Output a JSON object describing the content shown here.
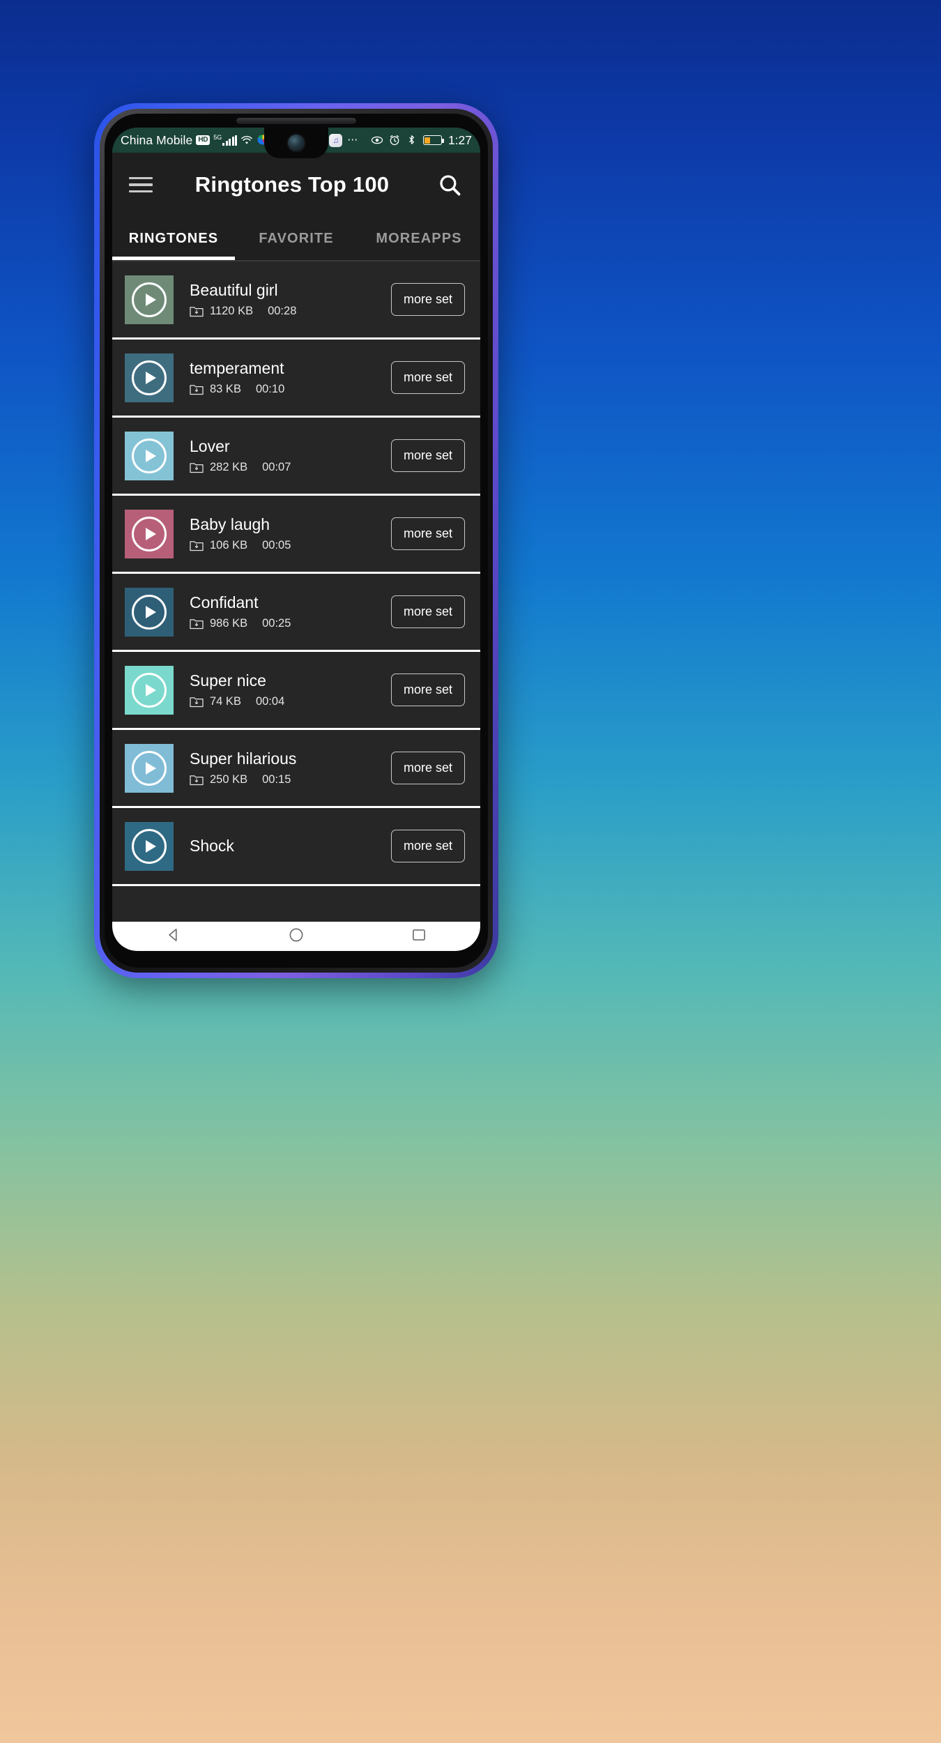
{
  "statusbar": {
    "carrier": "China Mobile",
    "hd_badge": "HD",
    "network_label": "5G",
    "time": "1:27",
    "icons": {
      "signal": "signal-bars-icon",
      "wifi": "wifi-icon",
      "color_app": "color-app-icon",
      "music": "music-notification-icon",
      "overflow": "more-notifications-icon",
      "eye": "eye-care-icon",
      "alarm": "alarm-clock-icon",
      "bluetooth": "bluetooth-icon",
      "battery": "battery-icon"
    }
  },
  "appbar": {
    "menu_icon": "hamburger-menu-icon",
    "title": "Ringtones Top 100",
    "search_icon": "search-icon"
  },
  "tabs": [
    {
      "label": "RINGTONES",
      "active": true
    },
    {
      "label": "FAVORITE",
      "active": false
    },
    {
      "label": "MOREAPPS",
      "active": false
    }
  ],
  "list": {
    "button_label": "more set",
    "items": [
      {
        "title": "Beautiful girl",
        "size": "1120 KB",
        "duration": "00:28",
        "color": "#6f8b78"
      },
      {
        "title": "temperament",
        "size": "83 KB",
        "duration": "00:10",
        "color": "#3f6d80"
      },
      {
        "title": "Lover",
        "size": "282 KB",
        "duration": "00:07",
        "color": "#84c3d6"
      },
      {
        "title": "Baby laugh",
        "size": "106 KB",
        "duration": "00:05",
        "color": "#b75f79"
      },
      {
        "title": "Confidant",
        "size": "986 KB",
        "duration": "00:25",
        "color": "#2f5f77"
      },
      {
        "title": "Super nice",
        "size": "74 KB",
        "duration": "00:04",
        "color": "#7ad9cc"
      },
      {
        "title": "Super hilarious",
        "size": "250 KB",
        "duration": "00:15",
        "color": "#80bcd6"
      },
      {
        "title": "Shock",
        "size": "",
        "duration": "",
        "color": "#2f6a84"
      }
    ]
  },
  "navbar": {
    "back": "back-triangle-icon",
    "home": "home-circle-icon",
    "recents": "recents-square-icon"
  }
}
